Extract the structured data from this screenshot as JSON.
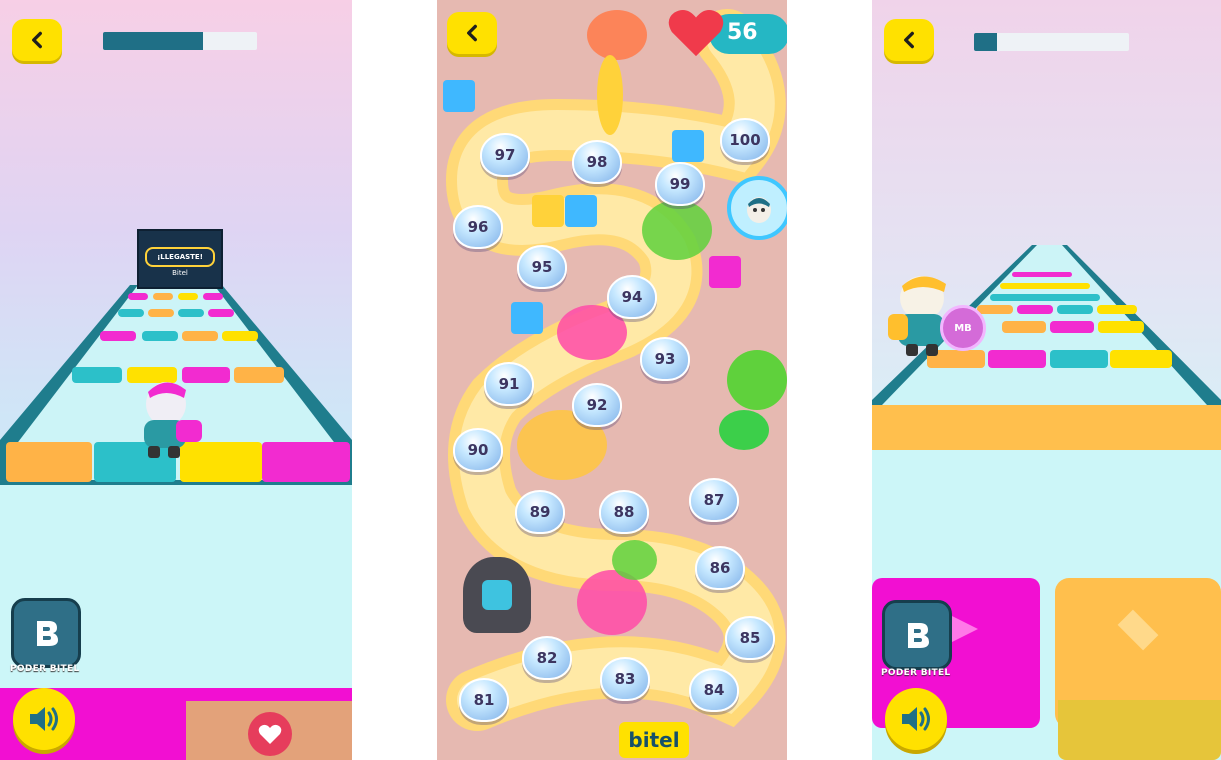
{
  "left_screen": {
    "progress_percent": 65,
    "finish_sign": {
      "title": "¡LLEGASTE!",
      "brand": "Bitel"
    },
    "power_label": "PODER BITEL"
  },
  "map_screen": {
    "lives": "56",
    "levels": [
      "81",
      "82",
      "83",
      "84",
      "85",
      "86",
      "87",
      "88",
      "89",
      "90",
      "91",
      "92",
      "93",
      "94",
      "95",
      "96",
      "97",
      "98",
      "99",
      "100"
    ],
    "brand": "bitel"
  },
  "right_screen": {
    "progress_percent": 15,
    "power_label": "PODER BITEL",
    "data_bonus": "MB"
  },
  "colors": {
    "yellow": "#ffe100",
    "teal": "#1f6f86",
    "magenta": "#f22bd0",
    "orange": "#ffb347",
    "cyan": "#2cc0c9"
  },
  "icons": [
    "back-icon",
    "speaker-icon",
    "heart-icon",
    "bitel-b-icon"
  ]
}
